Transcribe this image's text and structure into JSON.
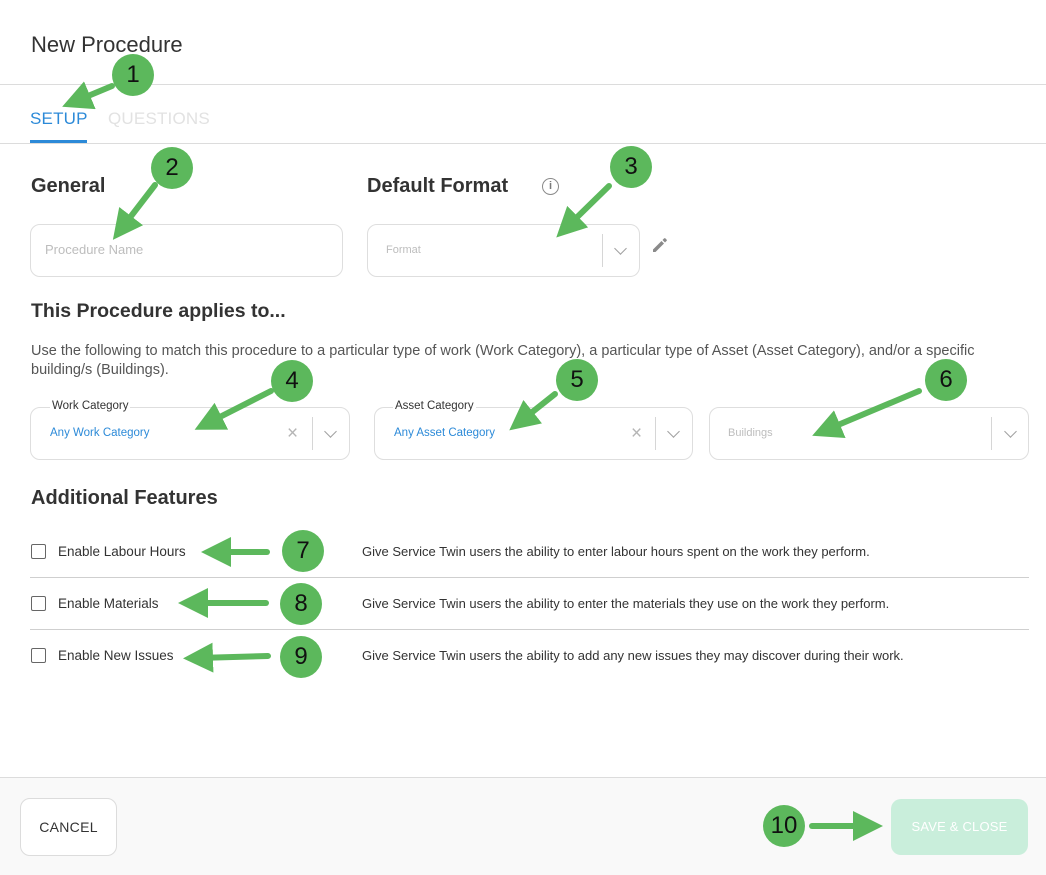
{
  "dialog": {
    "title": "New Procedure"
  },
  "tabs": [
    {
      "label": "SETUP",
      "active": true
    },
    {
      "label": "QUESTIONS",
      "active": false
    }
  ],
  "general": {
    "heading": "General",
    "name_placeholder": "Procedure Name"
  },
  "default_format": {
    "heading": "Default Format",
    "info_icon": "info-icon",
    "format_placeholder": "Format",
    "edit_icon": "pencil-icon"
  },
  "applies": {
    "heading": "This Procedure applies to...",
    "description": "Use the following to match this procedure to a particular type of work (Work Category), a particular type of Asset (Asset Category), and/or a specific building/s (Buildings).",
    "work_category": {
      "label": "Work Category",
      "value": "Any Work Category"
    },
    "asset_category": {
      "label": "Asset Category",
      "value": "Any Asset Category"
    },
    "buildings": {
      "placeholder": "Buildings"
    }
  },
  "features": {
    "heading": "Additional Features",
    "items": [
      {
        "label": "Enable Labour Hours",
        "description": "Give Service Twin users the ability to enter labour hours spent on the work they perform.",
        "checked": false
      },
      {
        "label": "Enable Materials",
        "description": "Give Service Twin users the ability to enter the materials they use on the work they perform.",
        "checked": false
      },
      {
        "label": "Enable New Issues",
        "description": "Give Service Twin users the ability to add any new issues they may discover during their work.",
        "checked": false
      }
    ]
  },
  "footer": {
    "cancel_label": "CANCEL",
    "save_label": "SAVE & CLOSE"
  },
  "annotations": {
    "badges": [
      "1",
      "2",
      "3",
      "4",
      "5",
      "6",
      "7",
      "8",
      "9",
      "10"
    ],
    "color": "#5cb85c"
  },
  "colors": {
    "accent": "#2c8ad8",
    "save_disabled": "#c9eedb"
  }
}
